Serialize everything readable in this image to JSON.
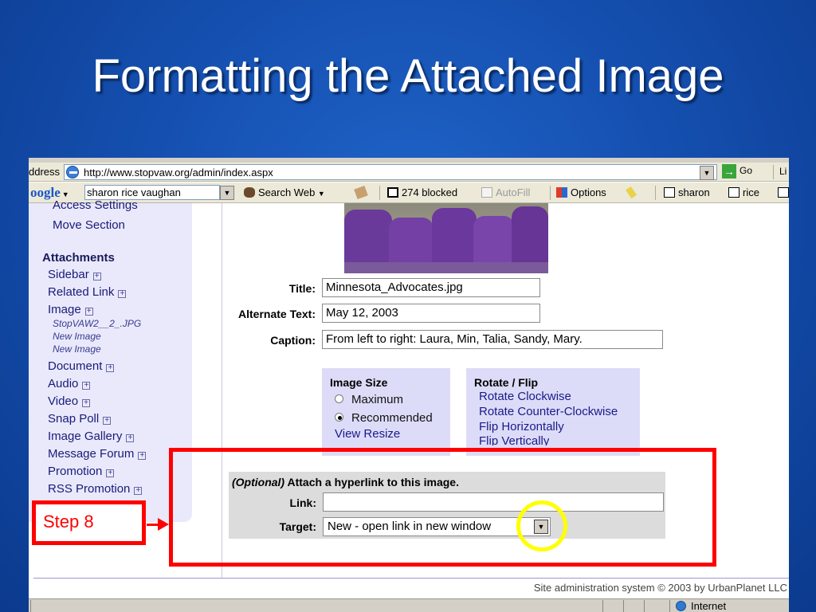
{
  "slide": {
    "title": "Formatting the Attached Image"
  },
  "browser": {
    "address_label": "ddress",
    "url": "http://www.stopvaw.org/admin/index.aspx",
    "go_label": "Go",
    "links_label": "Li",
    "dropdown_glyph": "▼"
  },
  "google_toolbar": {
    "logo": "oogle",
    "search_value": "sharon rice vaughan",
    "search_web": "Search Web",
    "popups_blocked": "274 blocked",
    "autofill": "AutoFill",
    "options": "Options",
    "term1": "sharon",
    "term2": "rice"
  },
  "sidebar": {
    "partial_item": "Access Settings",
    "move_section": "Move Section",
    "attachments_heading": "Attachments",
    "items": [
      "Sidebar",
      "Related Link",
      "Image",
      "Document",
      "Audio",
      "Video",
      "Snap Poll",
      "Image Gallery",
      "Message Forum",
      "Promotion",
      "RSS Promotion"
    ],
    "image_subitems": [
      "StopVAW2__2_.JPG",
      "New Image",
      "New Image"
    ],
    "expand_glyph": "+"
  },
  "form": {
    "title_label": "Title:",
    "title_value": "Minnesota_Advocates.jpg",
    "alt_label": "Alternate Text:",
    "alt_value": "May 12, 2003",
    "caption_label": "Caption:",
    "caption_value": "From left to right: Laura, Min, Talia, Sandy, Mary."
  },
  "image_size": {
    "heading": "Image Size",
    "option_max": "Maximum",
    "option_rec": "Recommended",
    "view_resize": "View Resize",
    "selected": "Recommended"
  },
  "rotate_flip": {
    "heading": "Rotate / Flip",
    "links": [
      "Rotate Clockwise",
      "Rotate Counter-Clockwise",
      "Flip Horizontally",
      "Flip Vertically"
    ]
  },
  "hyperlink": {
    "optional": "(Optional)",
    "heading_rest": " Attach a hyperlink to this image.",
    "link_label": "Link:",
    "link_value": "",
    "target_label": "Target:",
    "target_value": "New - open link in new window"
  },
  "footer": {
    "text": "Site administration system © 2003 by UrbanPlanet LLC"
  },
  "statusbar": {
    "zone": "Internet"
  },
  "annotation": {
    "step_label": "Step 8",
    "box_color": "#ff0000",
    "circle_color": "#ffff00"
  }
}
